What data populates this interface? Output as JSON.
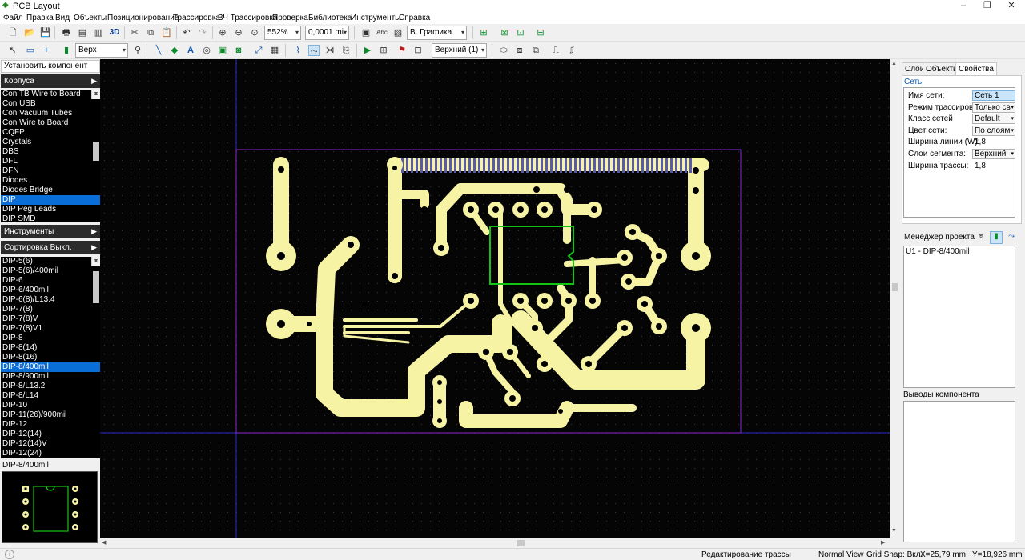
{
  "window": {
    "title": "PCB Layout"
  },
  "menu": [
    "Файл",
    "Правка",
    "Вид",
    "Объекты",
    "Позиционирование",
    "Трассировка",
    "ВЧ Трассировка",
    "Проверка",
    "Библиотека",
    "Инструменты",
    "Справка"
  ],
  "toolbar1": {
    "zoom": "552%",
    "grid": "0,0001 mi",
    "layer_view": "В. Графика",
    "label_3d": "3D"
  },
  "toolbar2": {
    "side": "Верх",
    "layer": "Верхний (1)"
  },
  "left": {
    "place_component": "Установить компонент",
    "cases_header": "Корпуса",
    "cases": [
      "Con TB Wire to Board",
      "Con USB",
      "Con Vacuum Tubes",
      "Con Wire to Board",
      "CQFP",
      "Crystals",
      "DBS",
      "DFL",
      "DFN",
      "Diodes",
      "Diodes Bridge",
      "DIP",
      "DIP Peg Leads",
      "DIP SMD"
    ],
    "cases_selected": 11,
    "tools_header": "Инструменты",
    "sort_header": "Сортировка Выкл.",
    "packages": [
      "DIP-5(6)",
      "DIP-5(6)/400mil",
      "DIP-6",
      "DIP-6/400mil",
      "DIP-6(8)/L13.4",
      "DIP-7(8)",
      "DIP-7(8)V",
      "DIP-7(8)V1",
      "DIP-8",
      "DIP-8(14)",
      "DIP-8(16)",
      "DIP-8/400mil",
      "DIP-8/900mil",
      "DIP-8/L13.2",
      "DIP-8/L14",
      "DIP-10",
      "DIP-11(26)/900mil",
      "DIP-12",
      "DIP-12(14)",
      "DIP-12(14)V",
      "DIP-12(24)"
    ],
    "packages_selected": 11,
    "preview_label": "DIP-8/400mil"
  },
  "right": {
    "tabs": [
      "Слои",
      "Объекты",
      "Свойства"
    ],
    "active_tab": 2,
    "net_title": "Сеть",
    "props": [
      {
        "k": "Имя сети:",
        "v": "Сеть 1",
        "type": "hl"
      },
      {
        "k": "Режим трассировки:",
        "v": "Только св",
        "type": "cb"
      },
      {
        "k": "Класс сетей",
        "v": "Default",
        "type": "cb"
      },
      {
        "k": "Цвет сети:",
        "v": "По слоям",
        "type": "cb"
      },
      {
        "k": "Ширина линии (W):",
        "v": "1,8",
        "type": "plain"
      },
      {
        "k": "Слои сегмента:",
        "v": "Верхний",
        "type": "cb"
      },
      {
        "k": "Ширина трассы:",
        "v": "1,8",
        "type": "plain"
      }
    ],
    "project_manager": "Менеджер проекта",
    "project_items": [
      "U1 - DIP-8/400mil"
    ],
    "component_pins": "Выводы компонента"
  },
  "status": {
    "mode": "Редактирование трассы",
    "view": "Normal View",
    "grid_snap": "Grid Snap: Вкл.",
    "x": "X=25,79 mm",
    "y": "Y=18,926 mm"
  },
  "colors": {
    "copper": "#f7f3a4",
    "board_outline": "#7a1fb0",
    "component": "#14c414",
    "axis": "#2b2bd0",
    "selection": "#0a6ed8"
  }
}
